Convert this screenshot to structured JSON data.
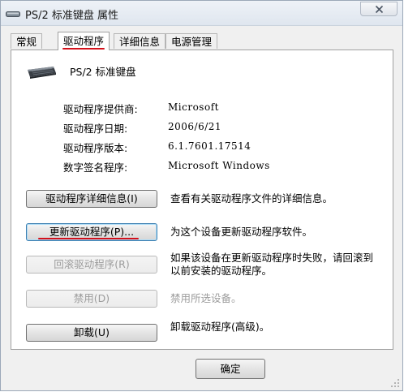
{
  "window": {
    "title": "PS/2 标准键盘 属性",
    "close_icon": "close-icon"
  },
  "tabs": [
    {
      "label": "常规",
      "active": false
    },
    {
      "label": "驱动程序",
      "active": true
    },
    {
      "label": "详细信息",
      "active": false
    },
    {
      "label": "电源管理",
      "active": false
    }
  ],
  "device": {
    "name": "PS/2 标准键盘",
    "icon": "keyboard-icon"
  },
  "driver_info": [
    {
      "label": "驱动程序提供商:",
      "value": "Microsoft"
    },
    {
      "label": "驱动程序日期:",
      "value": "2006/6/21"
    },
    {
      "label": "驱动程序版本:",
      "value": "6.1.7601.17514"
    },
    {
      "label": "数字签名程序:",
      "value": "Microsoft Windows"
    }
  ],
  "actions": [
    {
      "button": "驱动程序详细信息(I)",
      "description": "查看有关驱动程序文件的详细信息。",
      "enabled": true
    },
    {
      "button": "更新驱动程序(P)...",
      "description": "为这个设备更新驱动程序软件。",
      "enabled": true
    },
    {
      "button": "回滚驱动程序(R)",
      "description": "如果该设备在更新驱动程序时失败，请回滚到以前安装的驱动程序。",
      "enabled": false
    },
    {
      "button": "禁用(D)",
      "description": "禁用所选设备。",
      "enabled": false
    },
    {
      "button": "卸载(U)",
      "description": "卸载驱动程序(高级)。",
      "enabled": true
    }
  ],
  "footer": {
    "ok_label": "确定"
  },
  "colors": {
    "highlight_underline": "#d4101a"
  }
}
